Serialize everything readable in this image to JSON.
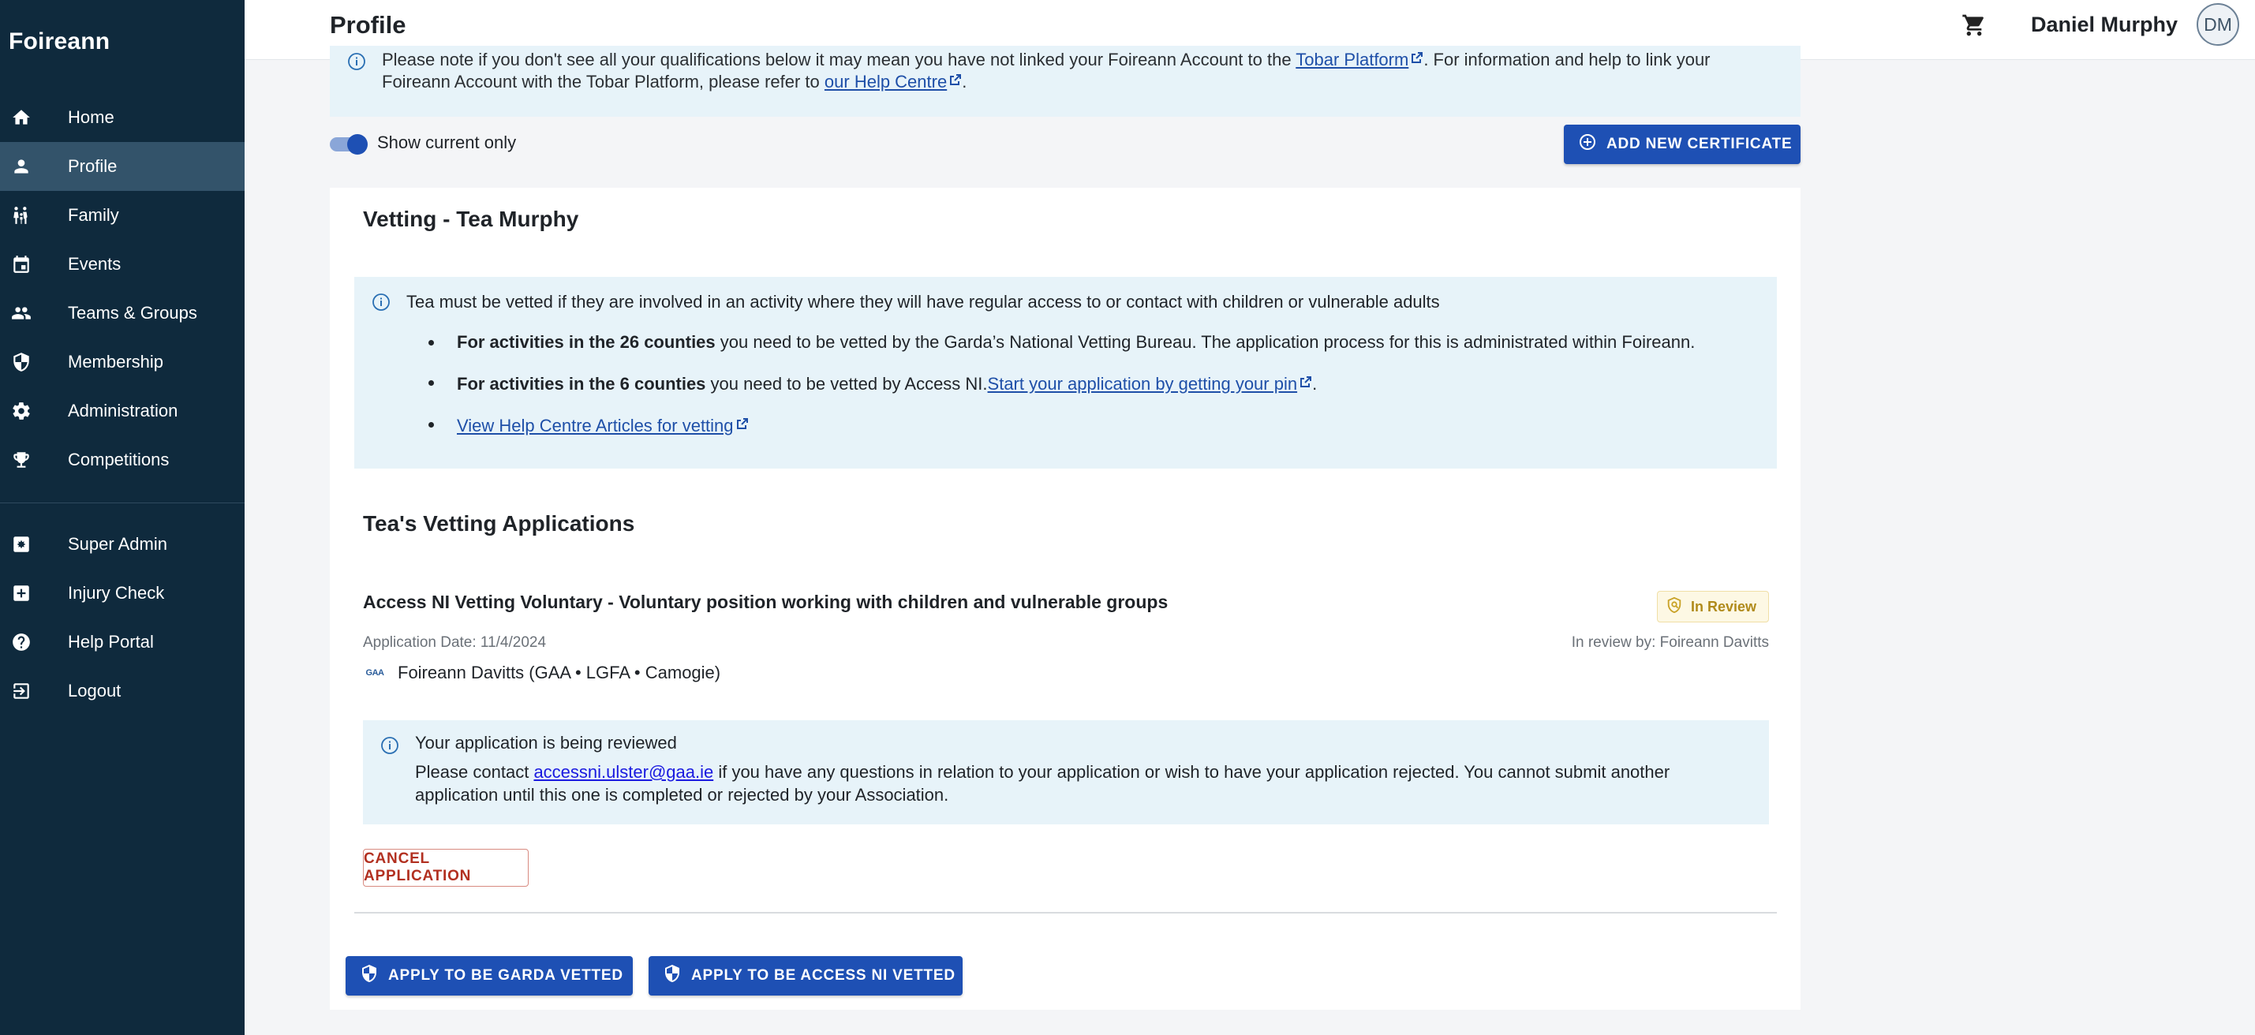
{
  "sidebar": {
    "brand": "Foireann",
    "items": [
      {
        "label": "Home",
        "icon": "home-icon"
      },
      {
        "label": "Profile",
        "icon": "person-icon",
        "active": true
      },
      {
        "label": "Family",
        "icon": "family-icon"
      },
      {
        "label": "Events",
        "icon": "calendar-icon"
      },
      {
        "label": "Teams & Groups",
        "icon": "group-icon"
      },
      {
        "label": "Membership",
        "icon": "shield-icon"
      },
      {
        "label": "Administration",
        "icon": "gear-icon"
      },
      {
        "label": "Competitions",
        "icon": "trophy-icon"
      }
    ],
    "secondary_items": [
      {
        "label": "Super Admin",
        "icon": "admin-icon"
      },
      {
        "label": "Injury Check",
        "icon": "medical-icon"
      },
      {
        "label": "Help Portal",
        "icon": "help-icon"
      },
      {
        "label": "Logout",
        "icon": "logout-icon"
      }
    ]
  },
  "header": {
    "title": "Profile",
    "user_name": "Daniel Murphy",
    "avatar_initials": "DM"
  },
  "notice": {
    "line1_text": "Please note if you don't see all your qualifications below it may mean you have not linked your Foireann Account to the ",
    "line1_link": "Tobar Platform",
    "line1_after": ". For information and help to link your",
    "line2_text": "Foireann Account with the Tobar Platform, please refer to ",
    "line2_link": "our Help Centre",
    "line2_after": "."
  },
  "filters": {
    "show_current_label": "Show current only",
    "show_current_on": true,
    "add_certificate_label": "ADD NEW CERTIFICATE"
  },
  "vetting": {
    "section_title": "Vetting - Tea Murphy",
    "info_lead": "Tea must be vetted if they are involved in an activity where they will have regular access to or contact with children or vulnerable adults",
    "bullet1_bold": "For activities in the 26 counties",
    "bullet1_text": " you need to be vetted by the Garda’s National Vetting Bureau. The application process for this is administrated within Foireann.",
    "bullet2_bold": "For activities in the 6 counties",
    "bullet2_text": " you need to be vetted by Access NI.",
    "bullet2_link": "Start your application by getting your pin",
    "bullet2_after": ".",
    "bullet3_link": "View Help Centre Articles for vetting"
  },
  "applications": {
    "section_title": "Tea's Vetting Applications",
    "items": [
      {
        "title": "Access NI Vetting Voluntary - Voluntary position working with children and vulnerable groups",
        "status": "In Review",
        "status_color": "#b08a1a",
        "application_date": "Application Date: 11/4/2024",
        "in_review_by": "In review by: Foireann Davitts",
        "org_logo_text": "GAA",
        "organisation": "Foireann Davitts (GAA • LGFA • Camogie)",
        "review_heading": "Your application is being reviewed",
        "review_text_before": "Please contact ",
        "review_email": "accessni.ulster@gaa.ie",
        "review_text_after": " if you have any questions in relation to your application or wish to have your application rejected. You cannot submit another",
        "review_text_line2": "application until this one is completed or rejected by your Association.",
        "cancel_label": "CANCEL APPLICATION"
      }
    ],
    "apply_garda_label": "APPLY TO BE GARDA VETTED",
    "apply_access_label": "APPLY TO BE ACCESS NI VETTED"
  },
  "colors": {
    "sidebar_bg": "#0f2a3d",
    "sidebar_active": "#33536a",
    "primary": "#1e50b4",
    "info_bg": "#e7f3f9",
    "danger": "#b23020"
  }
}
